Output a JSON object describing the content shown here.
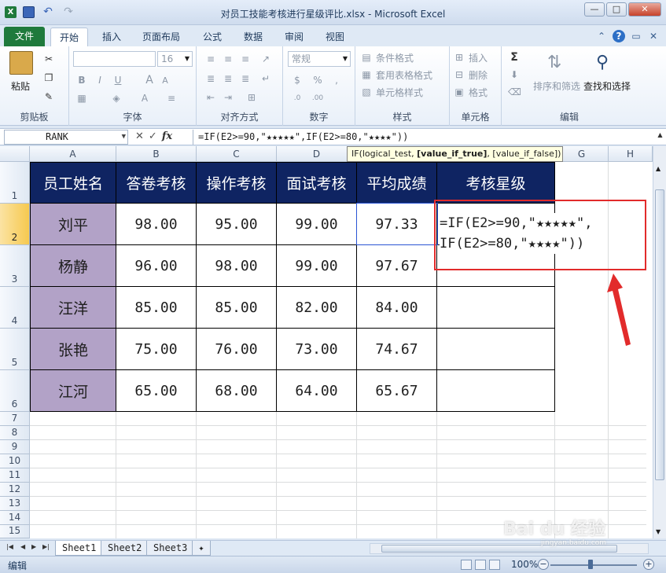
{
  "window": {
    "title": "对员工技能考核进行星级评比.xlsx - Microsoft Excel",
    "app_icon": "X",
    "buttons": [
      "—",
      "□",
      "✕"
    ]
  },
  "ribbon_tabs": {
    "file": "文件",
    "tabs": [
      "开始",
      "插入",
      "页面布局",
      "公式",
      "数据",
      "审阅",
      "视图"
    ],
    "active": "开始"
  },
  "ribbon": {
    "clipboard": {
      "paste": "粘贴",
      "label": "剪贴板"
    },
    "font": {
      "size": "16",
      "label": "字体",
      "bold": "B",
      "italic": "I",
      "underline": "U",
      "grow": "A",
      "shrink": "A"
    },
    "alignment": {
      "label": "对齐方式"
    },
    "number": {
      "format": "常规",
      "label": "数字"
    },
    "styles": {
      "conditional": "条件格式",
      "table": "套用表格格式",
      "cell": "单元格样式",
      "label": "样式"
    },
    "cells": {
      "insert": "插入",
      "delete": "删除",
      "format": "格式",
      "label": "单元格"
    },
    "editing": {
      "sum": "Σ",
      "sort": "排序和筛选",
      "find": "查找和选择",
      "label": "编辑"
    }
  },
  "formula_bar": {
    "name_box": "RANK",
    "cancel": "✕",
    "enter": "✓",
    "fx": "fx",
    "formula": "=IF(E2>=90,\"★★★★★\",IF(E2>=80,\"★★★★\"))"
  },
  "tooltip": {
    "prefix": "IF(logical_test, ",
    "bold": "[value_if_true]",
    "suffix": ", [value_if_false])"
  },
  "columns": [
    "A",
    "B",
    "C",
    "D",
    "E",
    "F",
    "G",
    "H"
  ],
  "rows": [
    "1",
    "2",
    "3",
    "4",
    "5",
    "6",
    "7",
    "8",
    "9",
    "10",
    "11",
    "12",
    "13",
    "14",
    "15"
  ],
  "table": {
    "headers": [
      "员工姓名",
      "答卷考核",
      "操作考核",
      "面试考核",
      "平均成绩",
      "考核星级"
    ],
    "data": [
      [
        "刘平",
        "98.00",
        "95.00",
        "99.00",
        "97.33"
      ],
      [
        "杨静",
        "96.00",
        "98.00",
        "99.00",
        "97.67"
      ],
      [
        "汪洋",
        "85.00",
        "85.00",
        "82.00",
        "84.00"
      ],
      [
        "张艳",
        "75.00",
        "76.00",
        "73.00",
        "74.67"
      ],
      [
        "江河",
        "65.00",
        "68.00",
        "64.00",
        "65.67"
      ]
    ]
  },
  "editing_cell": {
    "line1": "=IF(E2>=90,\"★★★★★\",",
    "line2": "IF(E2>=80,\"★★★★\"))"
  },
  "sheets": [
    "Sheet1",
    "Sheet2",
    "Sheet3"
  ],
  "active_sheet": "Sheet1",
  "status": {
    "mode": "编辑",
    "zoom": "100%"
  },
  "watermark": {
    "text": "Bai du 经验",
    "sub": "jingyan.baidu.com"
  },
  "colors": {
    "header_bg": "#0f2462",
    "name_bg": "#b2a2c7",
    "annotation": "#e22b2b",
    "file_tab": "#1f7a3c"
  }
}
